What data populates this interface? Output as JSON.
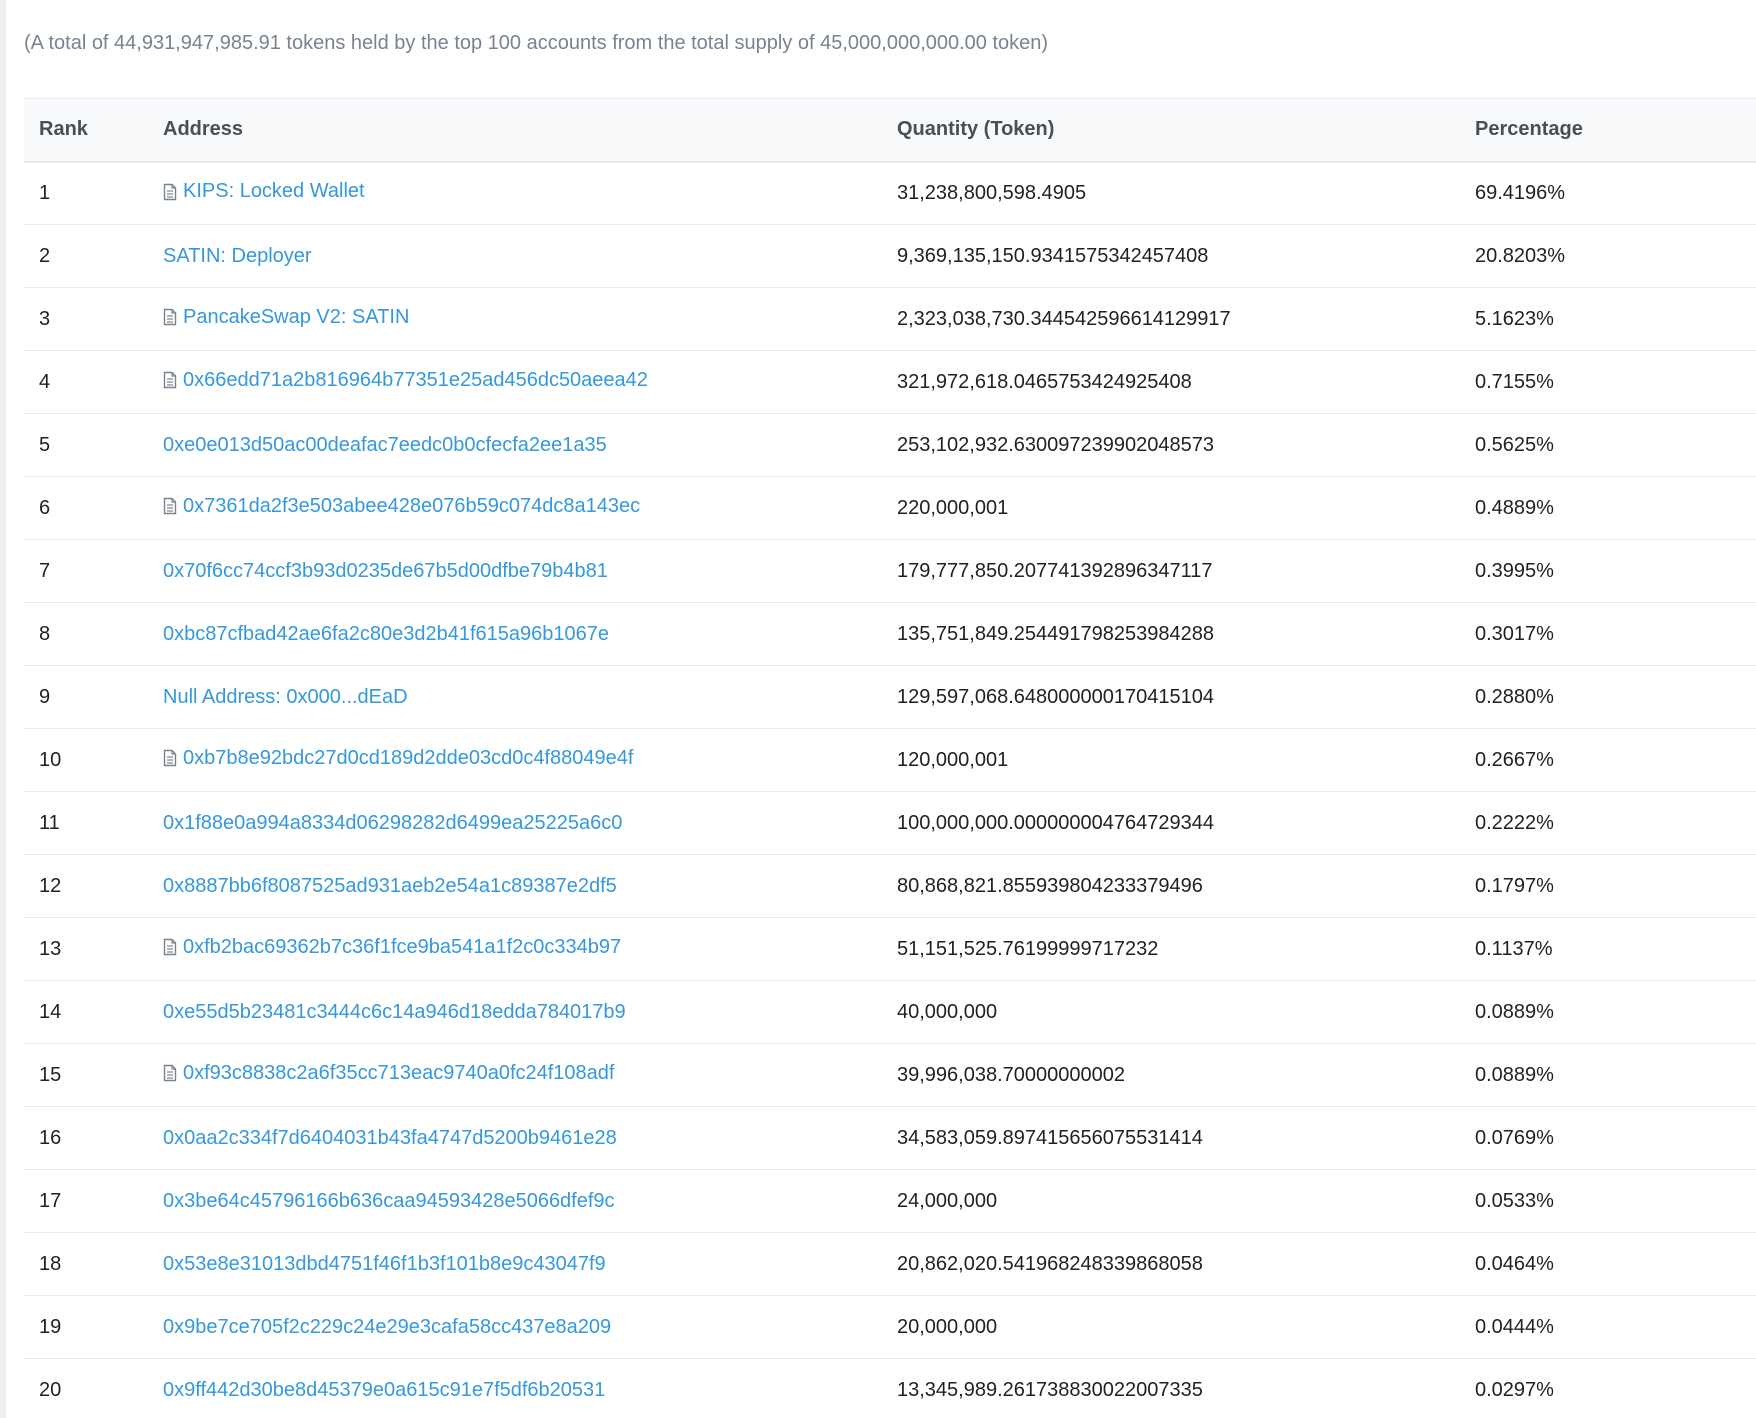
{
  "summary": "(A total of 44,931,947,985.91 tokens held by the top 100 accounts from the total supply of 45,000,000,000.00 token)",
  "columns": {
    "rank": "Rank",
    "address": "Address",
    "quantity": "Quantity (Token)",
    "percentage": "Percentage"
  },
  "icons": {
    "contract": "contract-document-icon"
  },
  "colors": {
    "link": "#3498db",
    "muted": "#77838f",
    "header_bg": "#f8f9fa"
  },
  "rows": [
    {
      "rank": "1",
      "address": "KIPS: Locked Wallet",
      "contract": true,
      "quantity": "31,238,800,598.4905",
      "percentage": "69.4196%"
    },
    {
      "rank": "2",
      "address": "SATIN: Deployer",
      "contract": false,
      "quantity": "9,369,135,150.9341575342457408",
      "percentage": "20.8203%"
    },
    {
      "rank": "3",
      "address": "PancakeSwap V2: SATIN",
      "contract": true,
      "quantity": "2,323,038,730.344542596614129917",
      "percentage": "5.1623%"
    },
    {
      "rank": "4",
      "address": "0x66edd71a2b816964b77351e25ad456dc50aeea42",
      "contract": true,
      "quantity": "321,972,618.0465753424925408",
      "percentage": "0.7155%"
    },
    {
      "rank": "5",
      "address": "0xe0e013d50ac00deafac7eedc0b0cfecfa2ee1a35",
      "contract": false,
      "quantity": "253,102,932.630097239902048573",
      "percentage": "0.5625%"
    },
    {
      "rank": "6",
      "address": "0x7361da2f3e503abee428e076b59c074dc8a143ec",
      "contract": true,
      "quantity": "220,000,001",
      "percentage": "0.4889%"
    },
    {
      "rank": "7",
      "address": "0x70f6cc74ccf3b93d0235de67b5d00dfbe79b4b81",
      "contract": false,
      "quantity": "179,777,850.207741392896347117",
      "percentage": "0.3995%"
    },
    {
      "rank": "8",
      "address": "0xbc87cfbad42ae6fa2c80e3d2b41f615a96b1067e",
      "contract": false,
      "quantity": "135,751,849.254491798253984288",
      "percentage": "0.3017%"
    },
    {
      "rank": "9",
      "address": "Null Address: 0x000...dEaD",
      "contract": false,
      "quantity": "129,597,068.648000000170415104",
      "percentage": "0.2880%"
    },
    {
      "rank": "10",
      "address": "0xb7b8e92bdc27d0cd189d2dde03cd0c4f88049e4f",
      "contract": true,
      "quantity": "120,000,001",
      "percentage": "0.2667%"
    },
    {
      "rank": "11",
      "address": "0x1f88e0a994a8334d06298282d6499ea25225a6c0",
      "contract": false,
      "quantity": "100,000,000.000000004764729344",
      "percentage": "0.2222%"
    },
    {
      "rank": "12",
      "address": "0x8887bb6f8087525ad931aeb2e54a1c89387e2df5",
      "contract": false,
      "quantity": "80,868,821.855939804233379496",
      "percentage": "0.1797%"
    },
    {
      "rank": "13",
      "address": "0xfb2bac69362b7c36f1fce9ba541a1f2c0c334b97",
      "contract": true,
      "quantity": "51,151,525.76199999717232",
      "percentage": "0.1137%"
    },
    {
      "rank": "14",
      "address": "0xe55d5b23481c3444c6c14a946d18edda784017b9",
      "contract": false,
      "quantity": "40,000,000",
      "percentage": "0.0889%"
    },
    {
      "rank": "15",
      "address": "0xf93c8838c2a6f35cc713eac9740a0fc24f108adf",
      "contract": true,
      "quantity": "39,996,038.70000000002",
      "percentage": "0.0889%"
    },
    {
      "rank": "16",
      "address": "0x0aa2c334f7d6404031b43fa4747d5200b9461e28",
      "contract": false,
      "quantity": "34,583,059.897415656075531414",
      "percentage": "0.0769%"
    },
    {
      "rank": "17",
      "address": "0x3be64c45796166b636caa94593428e5066dfef9c",
      "contract": false,
      "quantity": "24,000,000",
      "percentage": "0.0533%"
    },
    {
      "rank": "18",
      "address": "0x53e8e31013dbd4751f46f1b3f101b8e9c43047f9",
      "contract": false,
      "quantity": "20,862,020.541968248339868058",
      "percentage": "0.0464%"
    },
    {
      "rank": "19",
      "address": "0x9be7ce705f2c229c24e29e3cafa58cc437e8a209",
      "contract": false,
      "quantity": "20,000,000",
      "percentage": "0.0444%"
    },
    {
      "rank": "20",
      "address": "0x9ff442d30be8d45379e0a615c91e7f5df6b20531",
      "contract": false,
      "quantity": "13,345,989.261738830022007335",
      "percentage": "0.0297%"
    }
  ]
}
